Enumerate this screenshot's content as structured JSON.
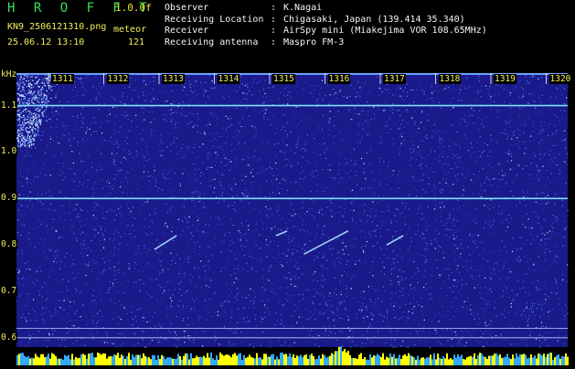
{
  "header": {
    "app_title": "H R O F F T",
    "version": "1.0.0f",
    "filename": "KN9_2506121310.png",
    "mode": "meteor",
    "datetime": "25.06.12 13:10",
    "count": "121"
  },
  "meta": [
    {
      "key": "Observer",
      "sep": ":",
      "value": "K.Nagai"
    },
    {
      "key": "Receiving Location",
      "sep": ":",
      "value": "Chigasaki, Japan (139.414 35.340)"
    },
    {
      "key": "Receiver",
      "sep": ":",
      "value": "AirSpy mini (Miakejima VOR 108.65MHz)"
    },
    {
      "key": "Receiving antenna",
      "sep": ":",
      "value": "Maspro FM-3"
    }
  ],
  "axis": {
    "unit": "kHz",
    "y_ticks": [
      "1.1",
      "1.0",
      "0.9",
      "0.8",
      "0.7",
      "0.6"
    ],
    "y_values": [
      1.1,
      1.0,
      0.9,
      0.8,
      0.7,
      0.6
    ],
    "x_ticks": [
      "1311",
      "1312",
      "1313",
      "1314",
      "1315",
      "1316",
      "1317",
      "1318",
      "1319",
      "1320"
    ]
  },
  "colors": {
    "background": "#1a1a8a",
    "noise": "#4a7cff",
    "carrier_line": "#7de0ff",
    "text": "#f2ee5a",
    "title": "#35e35c",
    "histogram": "#ffff00",
    "histogram_alt": "#33a8ff"
  },
  "chart_data": {
    "type": "heatmap",
    "title": "",
    "xlabel": "",
    "ylabel": "kHz",
    "x_categories": [
      "1311",
      "1312",
      "1313",
      "1314",
      "1315",
      "1316",
      "1317",
      "1318",
      "1319",
      "1320"
    ],
    "ylim": [
      0.58,
      1.17
    ],
    "carrier_lines_khz": [
      1.1,
      0.9
    ],
    "echoes": [
      {
        "time": 1312.9,
        "freq_start_khz": 0.79,
        "time_end": 1313.3,
        "freq_end_khz": 0.82
      },
      {
        "time": 1315.6,
        "freq_start_khz": 0.78,
        "time_end": 1316.4,
        "freq_end_khz": 0.83
      },
      {
        "time": 1317.1,
        "freq_start_khz": 0.8,
        "time_end": 1317.4,
        "freq_end_khz": 0.82
      },
      {
        "time": 1315.1,
        "freq_start_khz": 0.82,
        "time_end": 1315.3,
        "freq_end_khz": 0.83
      }
    ]
  }
}
